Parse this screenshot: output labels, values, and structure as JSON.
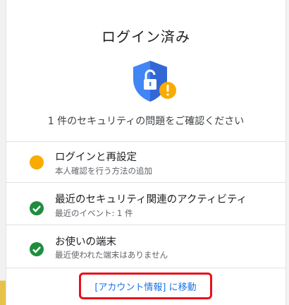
{
  "dialog": {
    "title": "ログイン済み",
    "summary": "1 件のセキュリティの問題をご確認ください",
    "shield_icon": "unlocked-shield-warning-icon"
  },
  "items": [
    {
      "title": "ログインと再設定",
      "subtitle": "本人確認を行う方法の追加",
      "status": "warning",
      "status_icon": "warning-dot-icon",
      "color": "#f9ab00"
    },
    {
      "title": "最近のセキュリティ関連のアクティビティ",
      "subtitle": "最近のイベント: 1 件",
      "status": "ok",
      "status_icon": "check-circle-icon",
      "color": "#1e8e3e"
    },
    {
      "title": "お使いの端末",
      "subtitle": "最近使われた端末はありません",
      "status": "ok",
      "status_icon": "check-circle-icon",
      "color": "#1e8e3e"
    }
  ],
  "footer": {
    "link_label": "[アカウント情報] に移動",
    "highlight_color": "#e8101a"
  },
  "colors": {
    "accent_blue": "#1a73e8",
    "shield_blue": "#4285f4",
    "warning": "#f9ab00",
    "ok": "#1e8e3e"
  }
}
